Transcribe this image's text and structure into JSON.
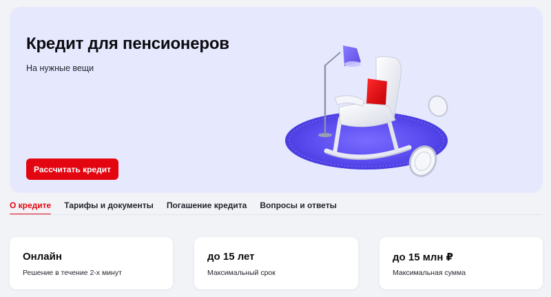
{
  "hero": {
    "title": "Кредит для пенсионеров",
    "subtitle": "На нужные вещи",
    "cta_label": "Рассчитать кредит",
    "illustration_icon": "rocking-chair-illustration"
  },
  "tabs": [
    {
      "label": "О кредите",
      "active": true
    },
    {
      "label": "Тарифы и документы",
      "active": false
    },
    {
      "label": "Погашение кредита",
      "active": false
    },
    {
      "label": "Вопросы и ответы",
      "active": false
    }
  ],
  "cards": [
    {
      "value": "Онлайн",
      "caption": "Решение в течение 2-х минут"
    },
    {
      "value": "до 15 лет",
      "caption": "Максимальный срок"
    },
    {
      "value": "до 15 млн ₽",
      "caption": "Максимальная сумма"
    }
  ],
  "colors": {
    "accent": "#e30611",
    "hero_bg": "#e6e8fe",
    "page_bg": "#f2f3f7",
    "rug": "#5b4cf0"
  }
}
